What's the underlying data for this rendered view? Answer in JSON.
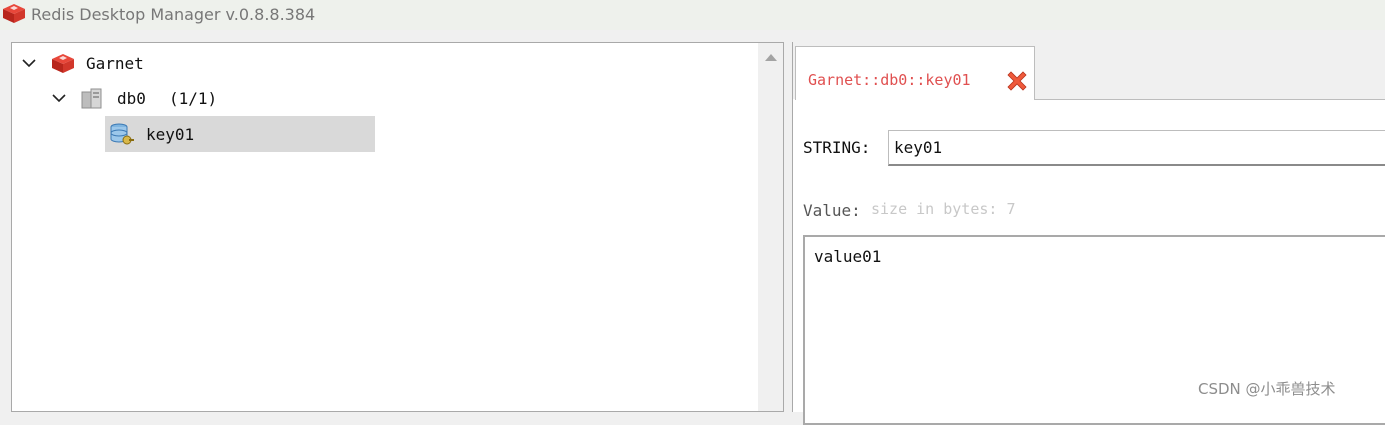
{
  "window": {
    "title": "Redis Desktop Manager v.0.8.8.384",
    "icon": "redis-logo-icon"
  },
  "tree": {
    "connection": {
      "label": "Garnet",
      "icon": "redis-server-icon",
      "expanded": true
    },
    "database": {
      "label": "db0",
      "count": "(1/1)",
      "icon": "database-icon",
      "expanded": true
    },
    "keys": [
      {
        "label": "key01",
        "icon": "key-icon",
        "selected": true
      }
    ]
  },
  "editor": {
    "tab": {
      "label": "Garnet::db0::key01",
      "close_icon": "close-icon",
      "label_color": "#e05050"
    },
    "key_type_label": "STRING:",
    "key_name_value": "key01",
    "value_label": "Value:",
    "value_size_text": "size in bytes: 7",
    "value_content": "value01"
  },
  "watermark": "CSDN @小乖兽技术"
}
